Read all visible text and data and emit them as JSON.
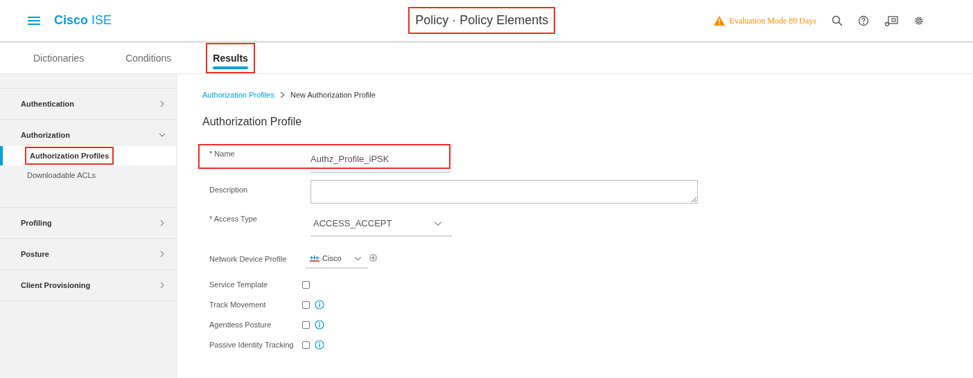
{
  "header": {
    "brand_bold": "Cisco",
    "brand_light": "ISE",
    "title": "Policy · Policy Elements",
    "title_highlighted": true,
    "warning": "Evaluation Mode 89 Days"
  },
  "tabs": [
    {
      "label": "Dictionaries",
      "selected": false,
      "highlighted": false
    },
    {
      "label": "Conditions",
      "selected": false,
      "highlighted": false
    },
    {
      "label": "Results",
      "selected": true,
      "highlighted": true
    }
  ],
  "sidebar": {
    "items": [
      {
        "label": "Authentication",
        "expanded": false
      },
      {
        "label": "Authorization",
        "expanded": true,
        "children": [
          {
            "label": "Authorization Profiles",
            "selected": true,
            "highlighted": true
          },
          {
            "label": "Downloadable ACLs",
            "selected": false,
            "highlighted": false
          }
        ]
      },
      {
        "label": "Profiling",
        "expanded": false
      },
      {
        "label": "Posture",
        "expanded": false
      },
      {
        "label": "Client Provisioning",
        "expanded": false
      }
    ]
  },
  "breadcrumb": {
    "link": "Authorization Profiles",
    "current": "New Authorization Profile"
  },
  "heading": "Authorization Profile",
  "fields": [
    {
      "kind": "text",
      "label": "* Name",
      "value": "Authz_Profile_iPSK",
      "highlighted": true
    },
    {
      "kind": "textarea",
      "label": "Description"
    },
    {
      "kind": "select",
      "label": "* Access Type",
      "value": "ACCESS_ACCEPT"
    },
    {
      "kind": "device",
      "label": "Network Device Profile",
      "value": "Cisco"
    },
    {
      "kind": "checkbox",
      "label": "Service Template",
      "checked": false,
      "info": false
    },
    {
      "kind": "checkbox",
      "label": "Track Movement",
      "checked": false,
      "info": true
    },
    {
      "kind": "checkbox",
      "label": "Agentless Posture",
      "checked": false,
      "info": true
    },
    {
      "kind": "checkbox",
      "label": "Passive Identity Tracking",
      "checked": false,
      "info": true
    }
  ]
}
